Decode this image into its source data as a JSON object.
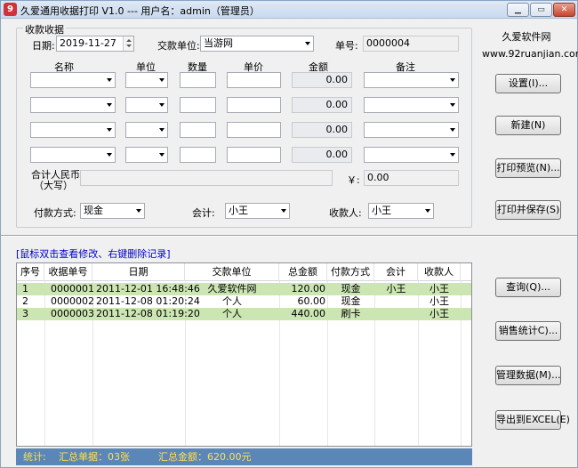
{
  "window": {
    "title": "久爱通用收据打印 V1.0 --- 用户名：admin（管理员）",
    "app_icon_glyph": "9",
    "controls": {
      "minimize": "▁",
      "maximize": "▭",
      "close": "✕"
    }
  },
  "receipt_group": {
    "title": "收款收据",
    "date_label": "日期:",
    "date_value": "2019-11-27",
    "payer_label": "交款单位:",
    "payer_value": "当游网",
    "number_label": "单号:",
    "number_value": "0000004",
    "columns": [
      "名称",
      "单位",
      "数量",
      "单价",
      "金额",
      "备注"
    ],
    "item_rows": [
      {
        "amount": "0.00"
      },
      {
        "amount": "0.00"
      },
      {
        "amount": "0.00"
      },
      {
        "amount": "0.00"
      }
    ],
    "total_label_line1": "合计人民币",
    "total_label_line2": "（大写）",
    "total_uppercase": "",
    "yen_label": "￥:",
    "total_value": "0.00",
    "payment_method_label": "付款方式:",
    "payment_method_value": "现金",
    "accountant_label": "会计:",
    "accountant_value": "小王",
    "cashier_label": "收款人:",
    "cashier_value": "小王"
  },
  "brand": {
    "name": "久爱软件网",
    "url": "www.92ruanjian.com"
  },
  "top_buttons": {
    "settings": "设置(I)...",
    "new": "新建(N)",
    "print_preview": "打印预览(N)...",
    "print_save": "打印并保存(S)"
  },
  "hint": "[鼠标双击查看修改、右键删除记录]",
  "records": {
    "headers": [
      "序号",
      "收据单号",
      "日期",
      "交款单位",
      "总金额",
      "付款方式",
      "会计",
      "收款人"
    ],
    "rows": [
      [
        "1",
        "0000001",
        "2011-12-01 16:48:46",
        "久爱软件网",
        "120.00",
        "现金",
        "小王",
        "小王"
      ],
      [
        "2",
        "0000002",
        "2011-12-08 01:20:24",
        "个人",
        "60.00",
        "现金",
        "",
        "小王"
      ],
      [
        "3",
        "0000003",
        "2011-12-08 01:19:20",
        "个人",
        "440.00",
        "刷卡",
        "",
        "小王"
      ]
    ]
  },
  "side_buttons": {
    "query": "查询(Q)...",
    "sales_stats": "销售统计C)...",
    "manage_data": "管理数据(M)...",
    "export_excel": "导出到EXCEL(E)"
  },
  "status_bar": {
    "label": "统计:",
    "receipt_count": "汇总单据：03张",
    "total_amount": "汇总金额：620.00元"
  },
  "colors": {
    "alt_row": "#cce6b3",
    "status_bg": "#5b86b8",
    "status_text": "#ffe14a",
    "hint_text": "#0000cc"
  }
}
